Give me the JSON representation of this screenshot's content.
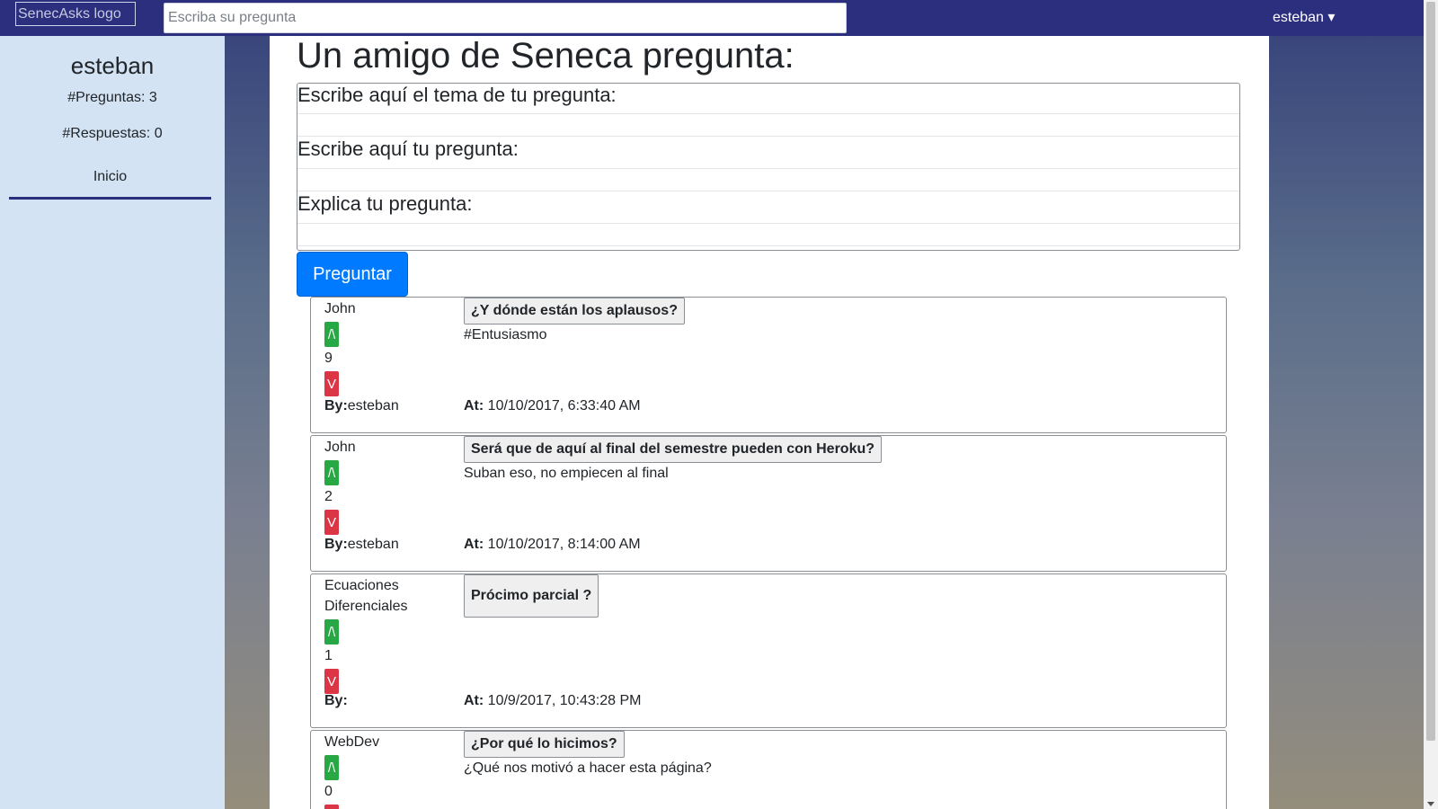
{
  "header": {
    "logo_alt": "SenecAsks logo",
    "search_placeholder": "Escriba su pregunta",
    "user_menu": "esteban ▾"
  },
  "sidebar": {
    "username": "esteban",
    "questions_count": "#Preguntas: 3",
    "answers_count": "#Respuestas: 0",
    "nav_home": "Inicio"
  },
  "main": {
    "title": "Un amigo de Seneca pregunta:",
    "form": {
      "topic_label": "Escribe aquí el tema de tu pregunta:",
      "question_label": "Escribe aquí tu pregunta:",
      "explain_label": "Explica tu pregunta:",
      "submit_label": "Preguntar"
    },
    "vote_up_label": "/\\",
    "vote_down_label": "V",
    "by_label": "By:",
    "at_label": "At:",
    "questions": [
      {
        "category": "John",
        "score": "9",
        "title": "¿Y dónde están los aplausos?",
        "body": "#Entusiasmo",
        "author": "esteban",
        "date": " 10/10/2017, 6:33:40 AM"
      },
      {
        "category": "John",
        "score": "2",
        "title": "Será que de aquí al final del semestre pueden con Heroku?",
        "body": "Suban eso, no empiecen al final",
        "author": "esteban",
        "date": " 10/10/2017, 8:14:00 AM"
      },
      {
        "category": "Ecuaciones Diferenciales",
        "score": "1",
        "title": "Prócimo parcial ?",
        "body": "",
        "author": "",
        "date": " 10/9/2017, 10:43:28 PM"
      },
      {
        "category": "WebDev",
        "score": "0",
        "title": "¿Por qué lo hicimos?",
        "body": "¿Qué nos motivó a hacer esta página?",
        "author": "",
        "date": ""
      }
    ]
  }
}
